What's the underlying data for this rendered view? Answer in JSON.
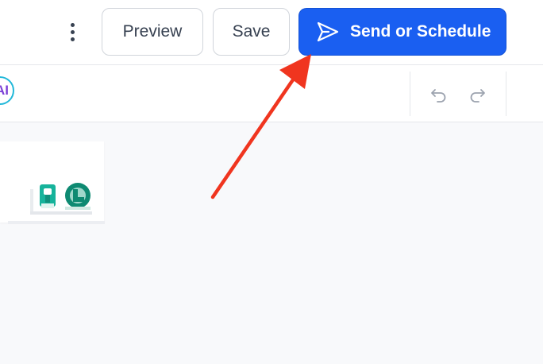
{
  "header": {
    "more_menu_icon": "kebab-vertical-icon",
    "preview_label": "Preview",
    "save_label": "Save",
    "send_label": "Send or Schedule",
    "send_icon": "paper-plane-icon"
  },
  "toolbar": {
    "ai_label": "AI",
    "undo_icon": "undo-icon",
    "redo_icon": "redo-icon"
  },
  "colors": {
    "primary": "#1a5ff1",
    "annotation_arrow": "#f0351f",
    "ai_ring": "#22b8d9",
    "ai_text": "#7b3fd6",
    "background": "#f8f9fb"
  }
}
